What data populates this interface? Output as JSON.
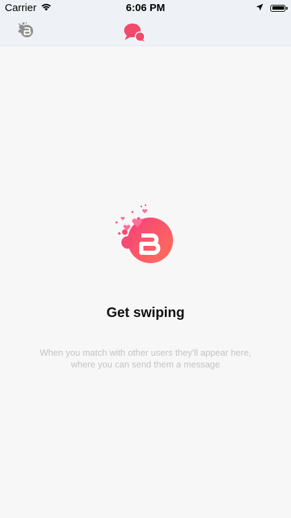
{
  "status_bar": {
    "carrier": "Carrier",
    "time": "6:06 PM",
    "icons": [
      "wifi-icon",
      "location-arrow-icon",
      "battery-icon"
    ]
  },
  "nav": {
    "logo_icon": "brand-logo-icon",
    "chat_icon": "chat-bubbles-icon",
    "active_color": "#f24a6c",
    "inactive_color": "#8e8e8e"
  },
  "empty_state": {
    "icon": "brand-hearts-logo-icon",
    "title": "Get swiping",
    "message": "When you match with other users they'll appear here, where you can send them a message"
  },
  "colors": {
    "accent": "#f24a6c",
    "background": "#f7f7f7",
    "nav_background": "#eef2f6"
  }
}
